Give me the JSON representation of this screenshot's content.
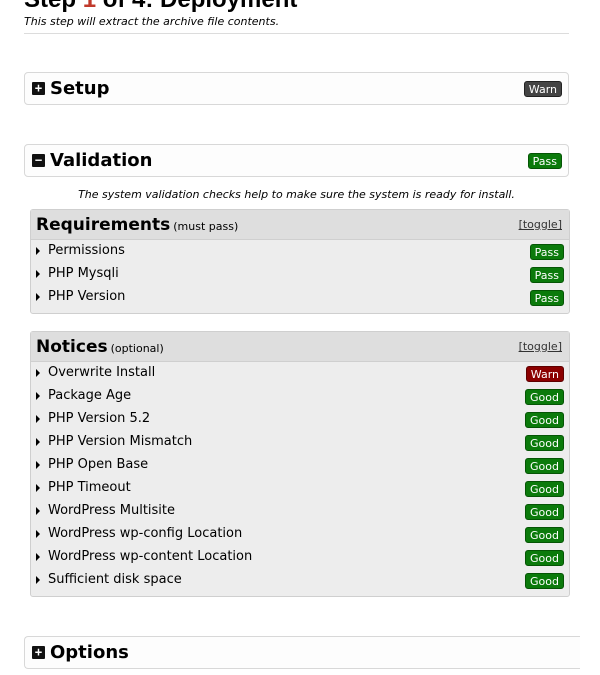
{
  "step": {
    "prefix": "Step ",
    "number": "1",
    "suffix": " of 4: Deployment",
    "subtitle": "This step will extract the archive file contents."
  },
  "setup": {
    "icon": "plus-box-icon",
    "title": "Setup",
    "status": "Warn"
  },
  "validation": {
    "icon": "minus-box-icon",
    "title": "Validation",
    "status": "Pass",
    "info": "The system validation checks help to make sure the system is ready for install."
  },
  "requirements": {
    "title": "Requirements",
    "subtitle": "(must pass)",
    "toggle": "[toggle]",
    "items": [
      {
        "label": "Permissions",
        "status": "Pass"
      },
      {
        "label": "PHP Mysqli",
        "status": "Pass"
      },
      {
        "label": "PHP Version",
        "status": "Pass"
      }
    ]
  },
  "notices": {
    "title": "Notices",
    "subtitle": "(optional)",
    "toggle": "[toggle]",
    "items": [
      {
        "label": "Overwrite Install",
        "status": "Warn"
      },
      {
        "label": "Package Age",
        "status": "Good"
      },
      {
        "label": "PHP Version 5.2",
        "status": "Good"
      },
      {
        "label": "PHP Version Mismatch",
        "status": "Good"
      },
      {
        "label": "PHP Open Base",
        "status": "Good"
      },
      {
        "label": "PHP Timeout",
        "status": "Good"
      },
      {
        "label": "WordPress Multisite",
        "status": "Good"
      },
      {
        "label": "WordPress wp-config Location",
        "status": "Good"
      },
      {
        "label": "WordPress wp-content Location",
        "status": "Good"
      },
      {
        "label": "Sufficient disk space",
        "status": "Good"
      }
    ]
  },
  "options": {
    "icon": "plus-box-icon",
    "title": "Options"
  },
  "colors": {
    "accent_step_number": "#c0392b",
    "pass": "#0b7a0b",
    "warn": "#8b0000",
    "warn_neutral": "#444444"
  }
}
